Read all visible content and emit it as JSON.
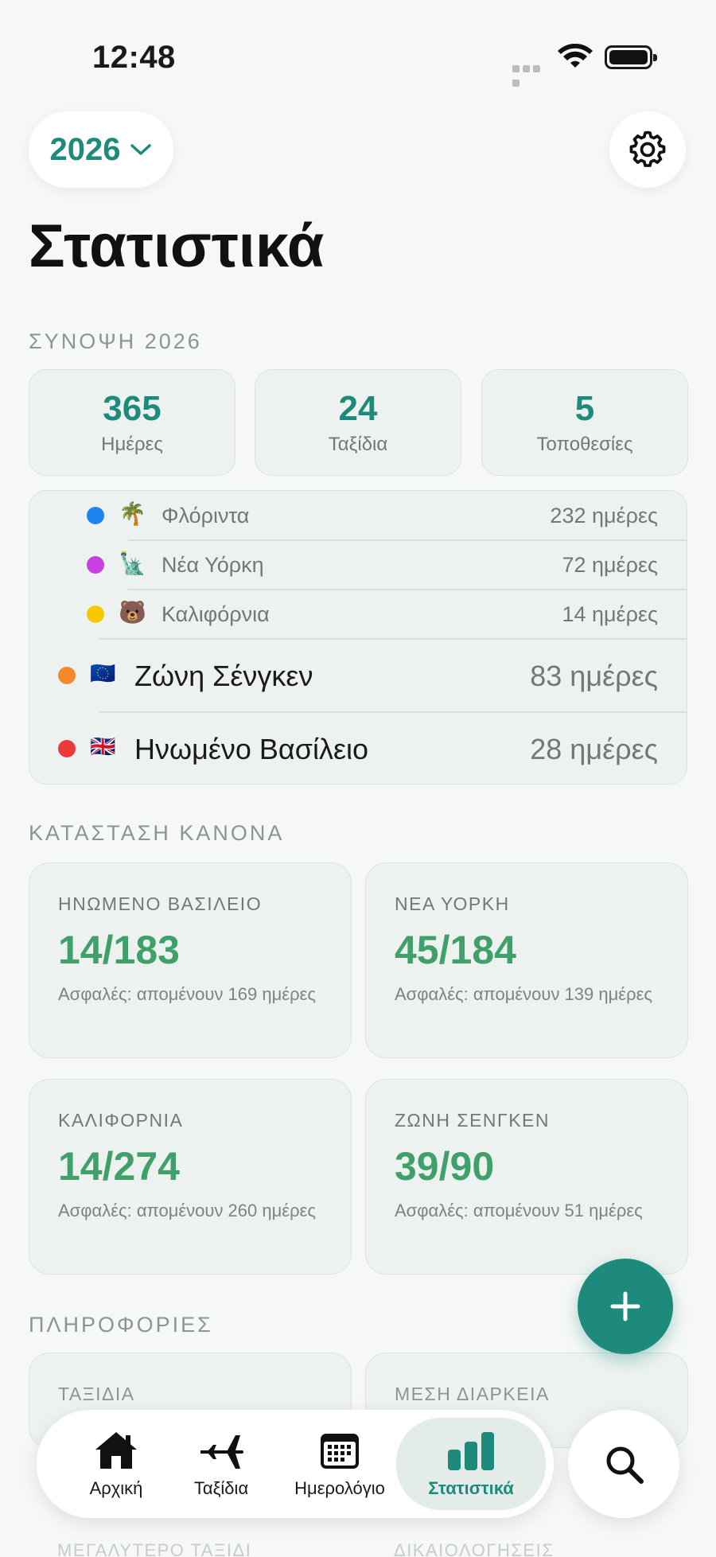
{
  "status_bar": {
    "time": "12:48"
  },
  "header": {
    "year": "2026",
    "title": "Στατιστικά"
  },
  "summary": {
    "section_title": "ΣΥΝΟΨΗ 2026",
    "cards": [
      {
        "value": "365",
        "label": "Ημέρες"
      },
      {
        "value": "24",
        "label": "Ταξίδια"
      },
      {
        "value": "5",
        "label": "Τοποθεσίες"
      }
    ]
  },
  "locations": [
    {
      "name": "Φλόριντα",
      "days": "232 ημέρες",
      "dot_color": "#1a84f0",
      "icon": "🌴"
    },
    {
      "name": "Νέα Υόρκη",
      "days": "72 ημέρες",
      "dot_color": "#c840e0",
      "icon": "🗽"
    },
    {
      "name": "Καλιφόρνια",
      "days": "14 ημέρες",
      "dot_color": "#f5c800",
      "icon": "🐻"
    },
    {
      "name": "Ζώνη Σένγκεν",
      "days": "83 ημέρες",
      "dot_color": "#f5892a",
      "icon": "🇪🇺"
    },
    {
      "name": "Ηνωμένο Βασίλειο",
      "days": "28 ημέρες",
      "dot_color": "#ec3a3a",
      "icon": "🇬🇧"
    }
  ],
  "rules": {
    "section_title": "ΚΑΤΑΣΤΑΣΗ ΚΑΝΟΝΑ",
    "cards": [
      {
        "heading": "ΗΝΩΜΕΝΟ ΒΑΣΙΛΕΙΟ",
        "value": "14/183",
        "status": "Ασφαλές: απομένουν 169 ημέρες"
      },
      {
        "heading": "ΝΕΑ ΥΟΡΚΗ",
        "value": "45/184",
        "status": "Ασφαλές: απομένουν 139 ημέρες"
      },
      {
        "heading": "ΚΑΛΙΦΟΡΝΙΑ",
        "value": "14/274",
        "status": "Ασφαλές: απομένουν 260 ημέρες"
      },
      {
        "heading": "ΖΩΝΗ ΣΕΝΓΚΕΝ",
        "value": "39/90",
        "status": "Ασφαλές: απομένουν 51 ημέρες"
      }
    ]
  },
  "info": {
    "section_title": "ΠΛΗΡΟΦΟΡΙΕΣ",
    "cards": [
      {
        "heading": "ΤΑΞΙΔΙΑ"
      },
      {
        "heading": "ΜΕΣΗ ΔΙΑΡΚΕΙΑ"
      }
    ],
    "lower_headings": [
      "ΜΕΓΑΛΥΤΕΡΟ ΤΑΞΙΔΙ",
      "ΔΙΚΑΙΟΛΟΓΗΣΕΙΣ"
    ]
  },
  "tabs": [
    {
      "label": "Αρχική",
      "icon": "house-icon"
    },
    {
      "label": "Ταξίδια",
      "icon": "airplane-icon"
    },
    {
      "label": "Ημερολόγιο",
      "icon": "calendar-icon"
    },
    {
      "label": "Στατιστικά",
      "icon": "chart-icon",
      "active": true
    }
  ],
  "colors": {
    "accent": "#1e8a7c",
    "safe": "#3fa06a"
  }
}
